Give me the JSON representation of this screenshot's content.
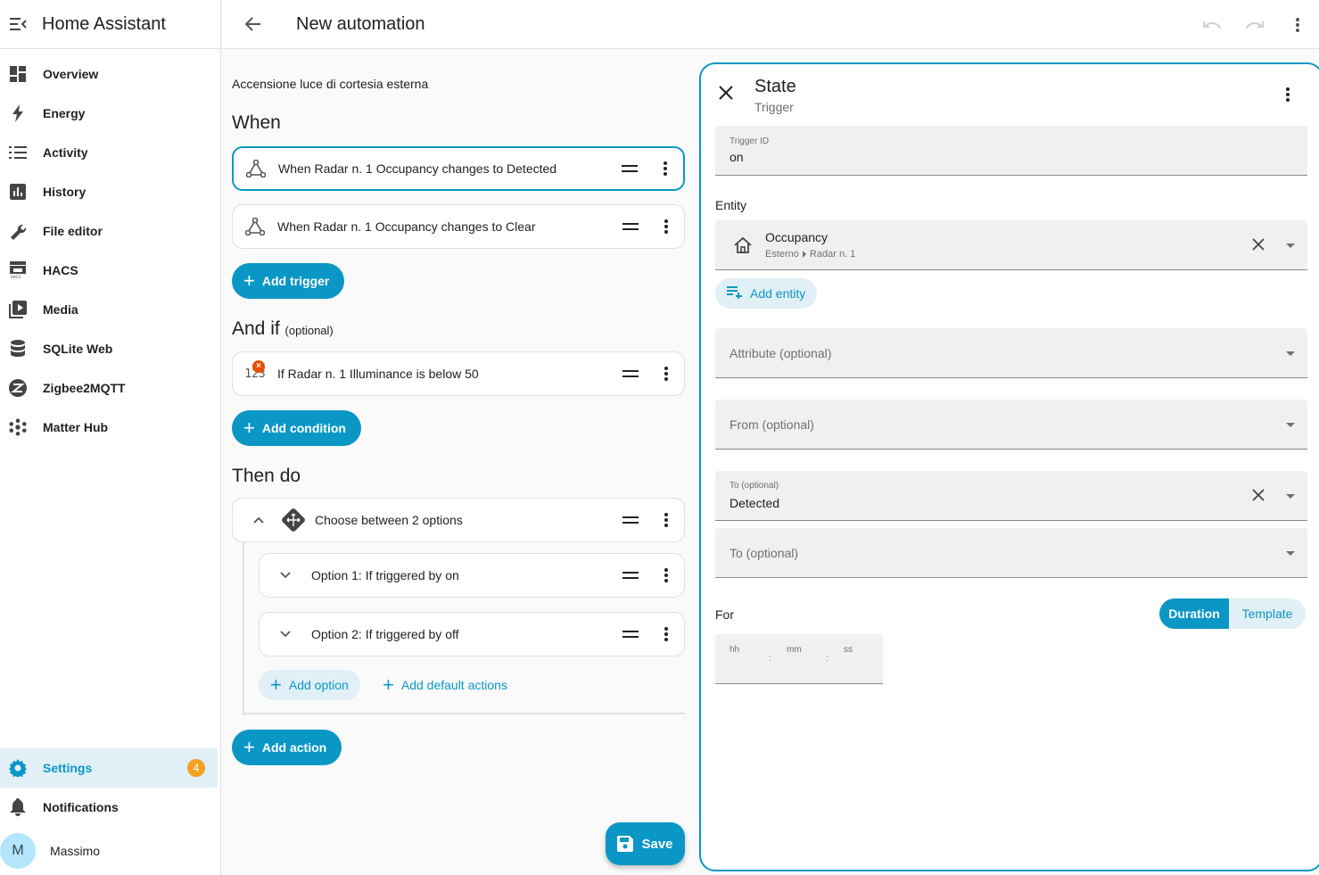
{
  "app": {
    "title": "Home Assistant"
  },
  "sidebar": {
    "items": [
      {
        "label": "Overview",
        "icon": "overview-icon"
      },
      {
        "label": "Energy",
        "icon": "energy-icon"
      },
      {
        "label": "Activity",
        "icon": "activity-icon"
      },
      {
        "label": "History",
        "icon": "history-icon"
      },
      {
        "label": "File editor",
        "icon": "wrench-icon"
      },
      {
        "label": "HACS",
        "icon": "hacs-icon"
      },
      {
        "label": "Media",
        "icon": "media-icon"
      },
      {
        "label": "SQLite Web",
        "icon": "database-icon"
      },
      {
        "label": "Zigbee2MQTT",
        "icon": "zigbee-icon"
      },
      {
        "label": "Matter Hub",
        "icon": "matter-icon"
      }
    ],
    "settings": {
      "label": "Settings",
      "badge": "4"
    },
    "notifications": {
      "label": "Notifications"
    },
    "user": {
      "initial": "M",
      "name": "Massimo"
    }
  },
  "topbar": {
    "title": "New automation"
  },
  "editor": {
    "description": "Accensione luce di cortesia esterna",
    "when": {
      "title": "When",
      "triggers": [
        {
          "text": "When Radar n. 1 Occupancy changes to Detected"
        },
        {
          "text": "When Radar n. 1 Occupancy changes to Clear"
        }
      ],
      "add_label": "Add trigger"
    },
    "andif": {
      "title": "And if",
      "optional": "(optional)",
      "conditions": [
        {
          "text": "If Radar n. 1 Illuminance is below 50",
          "error_mark": "×"
        }
      ],
      "add_label": "Add condition"
    },
    "then": {
      "title": "Then do",
      "choose": {
        "text": "Choose between 2 options"
      },
      "options": [
        {
          "text": "Option 1: If triggered by on"
        },
        {
          "text": "Option 2: If triggered by off"
        }
      ],
      "add_option": "Add option",
      "add_default": "Add default actions",
      "add_label": "Add action"
    },
    "save_label": "Save"
  },
  "panel": {
    "title": "State",
    "subtitle": "Trigger",
    "trigger_id": {
      "label": "Trigger ID",
      "value": "on"
    },
    "entity": {
      "label": "Entity",
      "name": "Occupancy",
      "area": "Esterno",
      "device": "Radar n. 1",
      "add_label": "Add entity"
    },
    "attribute": {
      "label": "Attribute (optional)"
    },
    "from": {
      "label": "From (optional)"
    },
    "to_selected": {
      "label": "To (optional)",
      "value": "Detected"
    },
    "to_empty": {
      "label": "To (optional)"
    },
    "for": {
      "label": "For",
      "mode_duration": "Duration",
      "mode_template": "Template",
      "hh": "hh",
      "mm": "mm",
      "ss": "ss",
      "sep": ":"
    }
  },
  "colors": {
    "accent": "#0a97c6",
    "accent_light": "#e1eff6",
    "badge": "#f0a221",
    "error": "#e65100"
  }
}
